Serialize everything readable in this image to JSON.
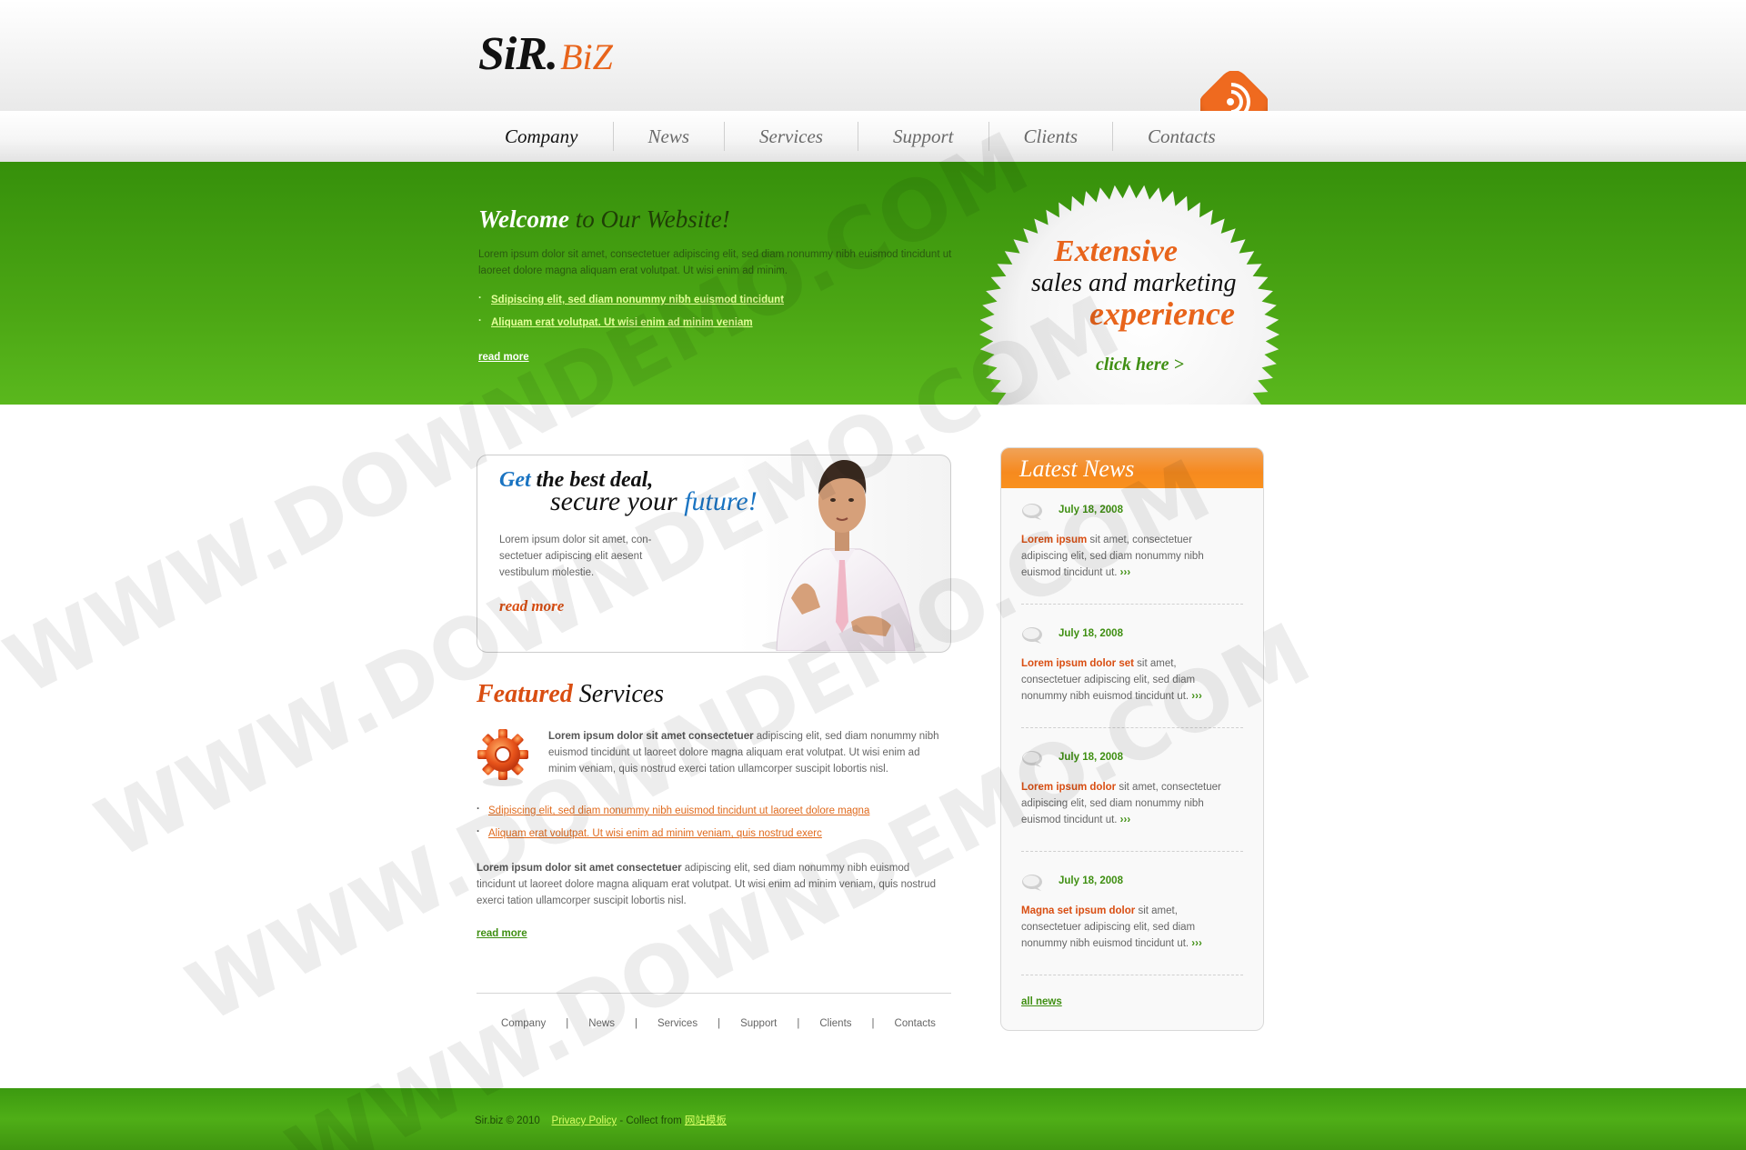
{
  "logo": {
    "main": "SiR.",
    "sub": "BiZ"
  },
  "nav": {
    "items": [
      {
        "label": "Company",
        "active": true
      },
      {
        "label": "News"
      },
      {
        "label": "Services"
      },
      {
        "label": "Support"
      },
      {
        "label": "Clients"
      },
      {
        "label": "Contacts"
      }
    ]
  },
  "hero": {
    "title_bold": "Welcome",
    "title_rest": " to Our Website!",
    "text": "Lorem ipsum dolor sit amet, consectetuer adipiscing elit, sed diam nonummy nibh euismod tincidunt ut laoreet dolore magna aliquam erat volutpat. Ut wisi enim ad minim.",
    "links": [
      "Sdipiscing elit, sed diam nonummy nibh euismod tincidunt",
      "Aliquam erat volutpat. Ut wisi enim ad minim veniam"
    ],
    "read_more": "read more"
  },
  "badge": {
    "line1": "Extensive",
    "line2": "sales and marketing",
    "line3": "experience",
    "click": "click here >"
  },
  "promo": {
    "get": "Get",
    "best_deal": " the best deal,",
    "secure": "secure your ",
    "future": "future!",
    "text": "Lorem ipsum dolor sit amet, con-sectetuer adipiscing elit aesent vestibulum molestie.",
    "read_more": "read more"
  },
  "featured": {
    "title_orange": "Featured",
    "title_dark": " Services",
    "lead_bold": "Lorem ipsum dolor sit amet consectetuer",
    "lead_text": " adipiscing elit, sed diam nonummy nibh euismod tincidunt ut laoreet dolore magna aliquam erat volutpat. Ut wisi enim ad minim veniam, quis nostrud exerci tation ullamcorper suscipit lobortis nisl.",
    "links": [
      "Sdipiscing elit, sed diam nonummy nibh euismod tincidunt ut laoreet dolore magna",
      "Aliquam erat volutpat. Ut wisi enim ad minim veniam, quis nostrud exerc"
    ],
    "para2_bold": "Lorem ipsum dolor sit amet consectetuer",
    "para2_text": " adipiscing elit, sed diam nonummy nibh euismod tincidunt ut laoreet dolore magna aliquam erat volutpat. Ut wisi enim ad minim veniam, quis nostrud exerci tation ullamcorper suscipit lobortis nisl.",
    "read_more": "read more"
  },
  "footer_nav": {
    "items": [
      "Company",
      "News",
      "Services",
      "Support",
      "Clients",
      "Contacts"
    ],
    "separator": "|"
  },
  "news": {
    "title": "Latest News",
    "items": [
      {
        "date": "July 18, 2008",
        "lead": "Lorem ipsum",
        "text": " sit amet, consectetuer adipiscing elit, sed diam nonummy nibh euismod tincidunt ut. ",
        "more": "›››"
      },
      {
        "date": "July 18, 2008",
        "lead": "Lorem ipsum dolor set",
        "text": " sit amet, consectetuer adipiscing elit, sed diam nonummy nibh euismod tincidunt ut. ",
        "more": "›››"
      },
      {
        "date": "July 18, 2008",
        "lead": "Lorem ipsum dolor",
        "text": " sit amet, consectetuer adipiscing elit, sed diam nonummy nibh euismod tincidunt ut. ",
        "more": "›››"
      },
      {
        "date": "July 18, 2008",
        "lead": "Magna set ipsum dolor",
        "text": " sit amet, consectetuer adipiscing elit, sed diam nonummy nibh euismod tincidunt ut. ",
        "more": "›››"
      }
    ],
    "all_news": "all news"
  },
  "footer": {
    "copyright": "Sir.biz © 2010",
    "privacy": "Privacy Policy",
    "collect": " - Collect from ",
    "collect_link": "网站模板"
  },
  "watermark": "WWW.DOWNDEMO.COM",
  "colors": {
    "green": "#4ba614",
    "orange": "#e8641b",
    "blue": "#1a74c2",
    "news_orange": "#f68a1f"
  }
}
